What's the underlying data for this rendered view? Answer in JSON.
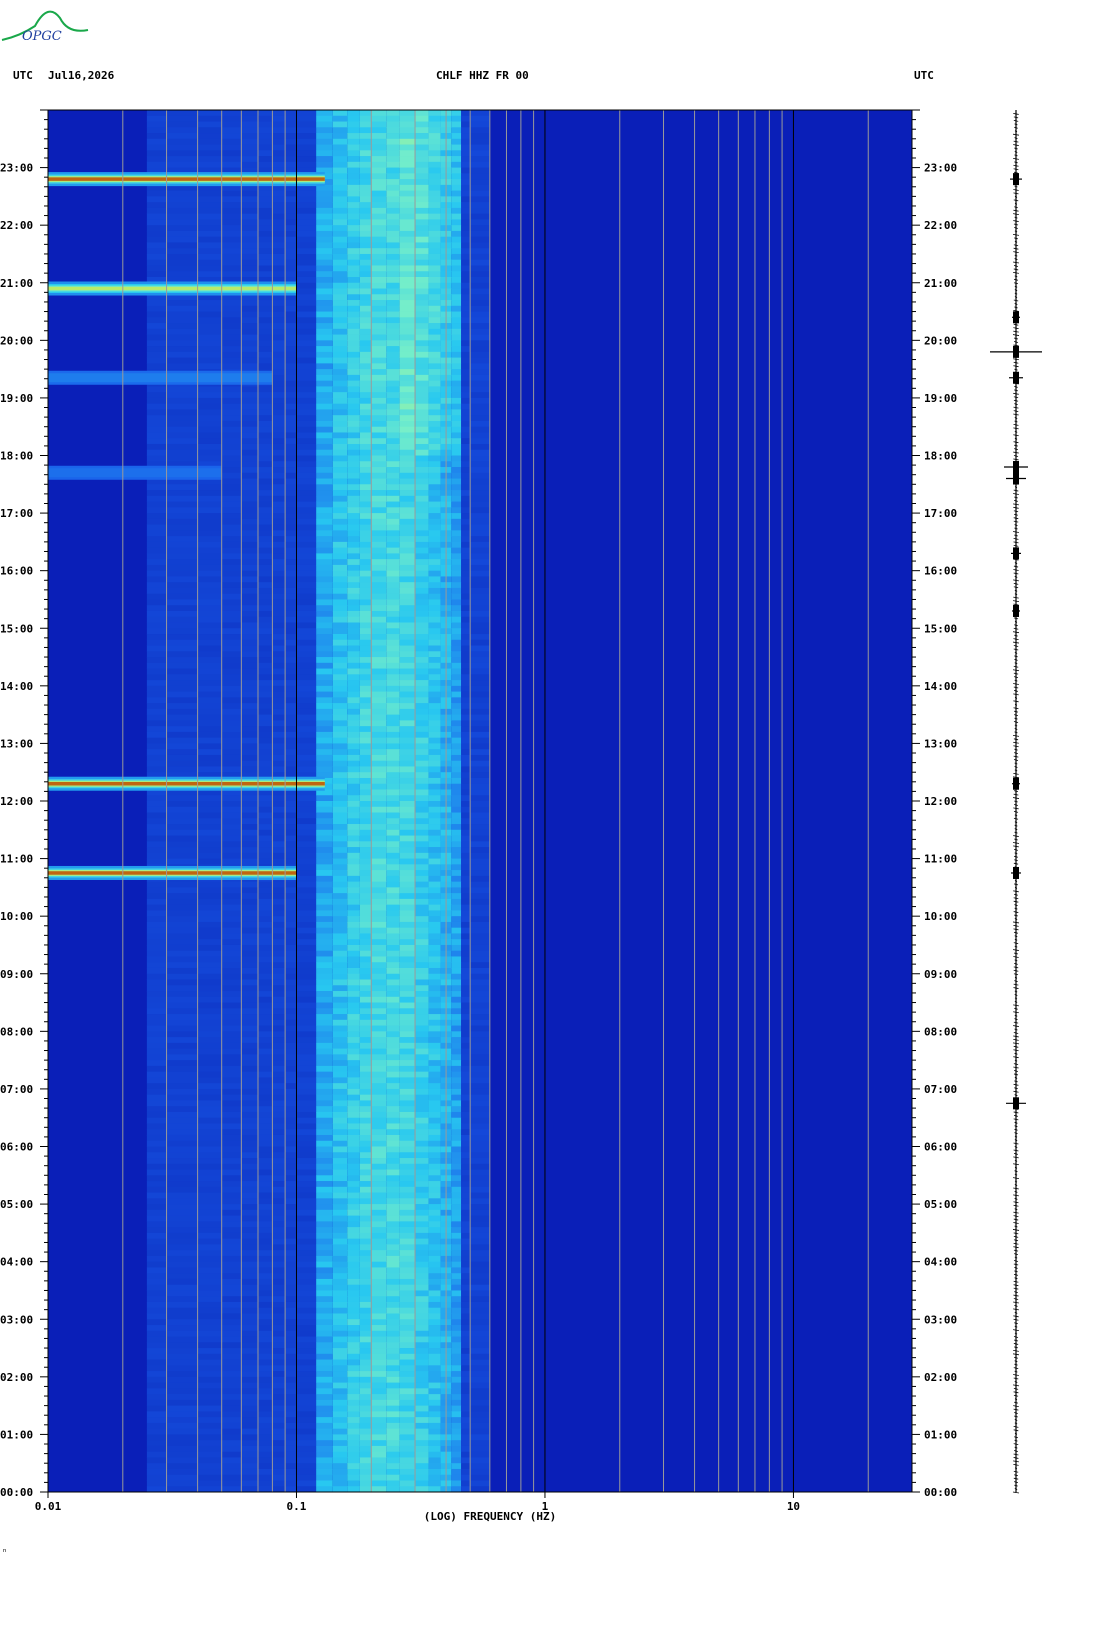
{
  "header": {
    "utc_left": "UTC",
    "date": "Jul16,2026",
    "station": "CHLF HHZ FR 00",
    "utc_right": "UTC"
  },
  "logo": {
    "text": "OPGC",
    "color": "#1aa84a"
  },
  "footnote": "ⁿ",
  "chart_data": {
    "type": "heatmap",
    "xlabel": "(LOG) FREQUENCY (HZ)",
    "xscale": "log",
    "xlim": [
      0.01,
      30
    ],
    "x_ticks": [
      {
        "value": 0.01,
        "label": "0.01"
      },
      {
        "value": 0.1,
        "label": "0.1"
      },
      {
        "value": 1,
        "label": "1"
      },
      {
        "value": 10,
        "label": "10"
      }
    ],
    "ylim_hours": [
      0,
      24
    ],
    "y_ticks": [
      "00:00",
      "01:00",
      "02:00",
      "03:00",
      "04:00",
      "05:00",
      "06:00",
      "07:00",
      "08:00",
      "09:00",
      "10:00",
      "11:00",
      "12:00",
      "13:00",
      "14:00",
      "15:00",
      "16:00",
      "17:00",
      "18:00",
      "19:00",
      "20:00",
      "21:00",
      "22:00",
      "23:00"
    ],
    "colors": {
      "background": "#0a1fb8",
      "low": "#0828c0",
      "mid": "#1f6ff0",
      "high": "#2ad8f0",
      "hot": "#f2e418",
      "peak": "#9a0a0a"
    },
    "microseism_band_hz": [
      0.12,
      0.45
    ],
    "events": [
      {
        "hour": 22.8,
        "fmax": 0.13,
        "strength": 1.0
      },
      {
        "hour": 20.9,
        "fmax": 0.1,
        "strength": 0.8
      },
      {
        "hour": 12.3,
        "fmax": 0.13,
        "strength": 1.0
      },
      {
        "hour": 10.75,
        "fmax": 0.1,
        "strength": 1.0
      },
      {
        "hour": 19.35,
        "fmax": 0.08,
        "strength": 0.25
      },
      {
        "hour": 17.7,
        "fmax": 0.05,
        "strength": 0.15
      }
    ],
    "trace_events": [
      {
        "hour": 22.8,
        "amp": 6
      },
      {
        "hour": 20.4,
        "amp": 4
      },
      {
        "hour": 19.8,
        "amp": 26
      },
      {
        "hour": 19.35,
        "amp": 7
      },
      {
        "hour": 17.8,
        "amp": 12
      },
      {
        "hour": 17.6,
        "amp": 10
      },
      {
        "hour": 16.3,
        "amp": 5
      },
      {
        "hour": 15.3,
        "amp": 4
      },
      {
        "hour": 12.3,
        "amp": 4
      },
      {
        "hour": 10.75,
        "amp": 5
      },
      {
        "hour": 6.75,
        "amp": 10
      }
    ]
  }
}
